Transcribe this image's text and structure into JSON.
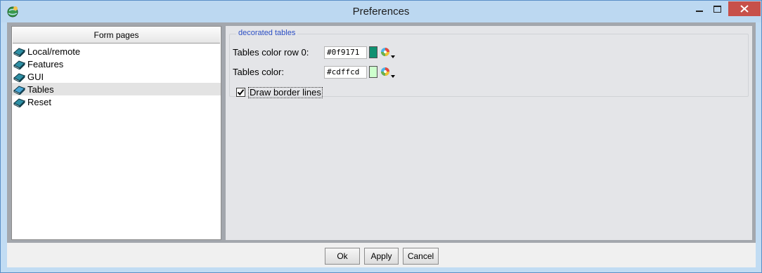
{
  "window": {
    "title": "Preferences"
  },
  "form_pages": {
    "header": "Form pages",
    "items": [
      {
        "label": "Local/remote",
        "selected": false
      },
      {
        "label": "Features",
        "selected": false
      },
      {
        "label": "GUI",
        "selected": false
      },
      {
        "label": "Tables",
        "selected": true
      },
      {
        "label": "Reset",
        "selected": false
      }
    ]
  },
  "decorated_tables": {
    "group_title": "decorated tables",
    "row0_label": "Tables color row 0:",
    "row0_value": "#0f9171",
    "row0_color": "#0f9171",
    "color_label": "Tables color:",
    "color_value": "#cdffcd",
    "color_color": "#cdffcd",
    "draw_border_label": "Draw border lines",
    "draw_border_checked": true
  },
  "buttons": {
    "ok": "Ok",
    "apply": "Apply",
    "cancel": "Cancel"
  },
  "colors": {
    "titlebar": "#bcd8f1",
    "close_button": "#c7504a",
    "group_title": "#2c4fc4"
  }
}
